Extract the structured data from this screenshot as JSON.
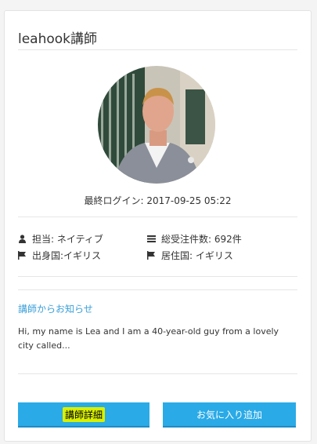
{
  "card": {
    "title": "leahook講師",
    "avatar_alt": "teacher-photo",
    "last_login": "最終ログイン: 2017-09-25 05:22"
  },
  "info": {
    "role": "担当: ネイティブ",
    "orders": "総受注件数: 692件",
    "origin": "出身国:イギリス",
    "residence": "居住国: イギリス"
  },
  "notice": {
    "heading": "講師からお知らせ",
    "body": "Hi, my name is Lea and I am a 40-year-old guy from a lovely city called..."
  },
  "buttons": {
    "detail": "講師詳細",
    "favorite": "お気に入り追加"
  },
  "icons": {
    "role": "user-icon",
    "orders": "list-icon",
    "origin": "flag-icon",
    "residence": "flag-icon"
  },
  "colors": {
    "accent": "#2aaae6",
    "link": "#3a9fd8",
    "highlight": "#d8f000"
  }
}
